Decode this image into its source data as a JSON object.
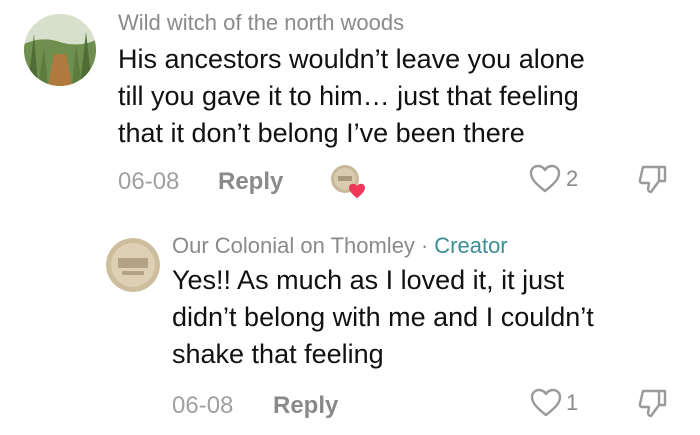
{
  "comments": [
    {
      "author": "Wild witch of the north woods",
      "text_lines": [
        "His ancestors wouldn’t leave you alone",
        "till you gave it to him… just that feeling",
        "that it don’t belong I’ve been there"
      ],
      "date": "06-08",
      "reply_label": "Reply",
      "likes": "2",
      "liked_by_creator": true
    },
    {
      "author": "Our Colonial on Thomley",
      "separator": "·",
      "badge": "Creator",
      "text_lines": [
        "Yes!! As much as I loved it, it just",
        "didn’t belong with me and I couldn’t",
        "shake that feeling"
      ],
      "date": "06-08",
      "reply_label": "Reply",
      "likes": "1"
    }
  ],
  "colors": {
    "creator_accent": "#3a8e95",
    "liked_heart": "#f2385a",
    "muted_text": "#8a8a8a"
  },
  "icons": [
    "heart-outline-icon",
    "thumbs-down-icon",
    "filled-heart-icon"
  ]
}
